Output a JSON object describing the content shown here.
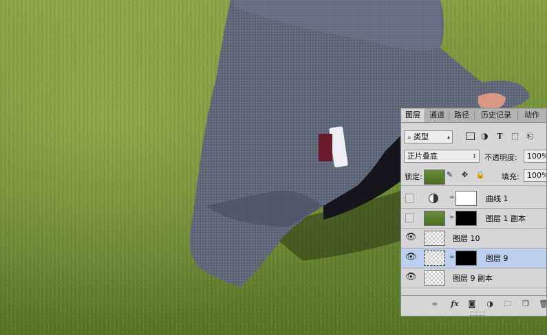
{
  "colors": {
    "grass_light": "#7d9a3e",
    "grass_dark": "#4e6b22",
    "coat": "#5e6879",
    "panel_bg": "#d6d6d6",
    "selected_row": "#bcd0ee"
  },
  "panel": {
    "tabs": [
      "图层",
      "通道",
      "路径",
      "历史记录",
      "动作"
    ],
    "filter": {
      "icon": "search-icon",
      "label": "类型"
    },
    "blend_mode": "正片叠底",
    "opacity": {
      "label": "不透明度:",
      "value": "100%"
    },
    "lock": {
      "label": "锁定:"
    },
    "fill": {
      "label": "填充:",
      "value": "100%"
    }
  },
  "layers": [
    {
      "name": "曲线 1",
      "visible": false,
      "type": "adjustment"
    },
    {
      "name": "图层 1 副本",
      "visible": false,
      "type": "masked-photo"
    },
    {
      "name": "图层 10",
      "visible": true,
      "type": "transparent"
    },
    {
      "name": "图层 9",
      "visible": true,
      "type": "masked-selected",
      "selected": true
    },
    {
      "name": "图层 9 副本",
      "visible": true,
      "type": "transparent"
    }
  ],
  "bottom_icons": [
    "link-icon",
    "fx-icon",
    "mask-icon",
    "adjustment-icon",
    "folder-icon",
    "new-layer-icon",
    "trash-icon"
  ],
  "bottom_labels": {
    "fx": "fx"
  }
}
